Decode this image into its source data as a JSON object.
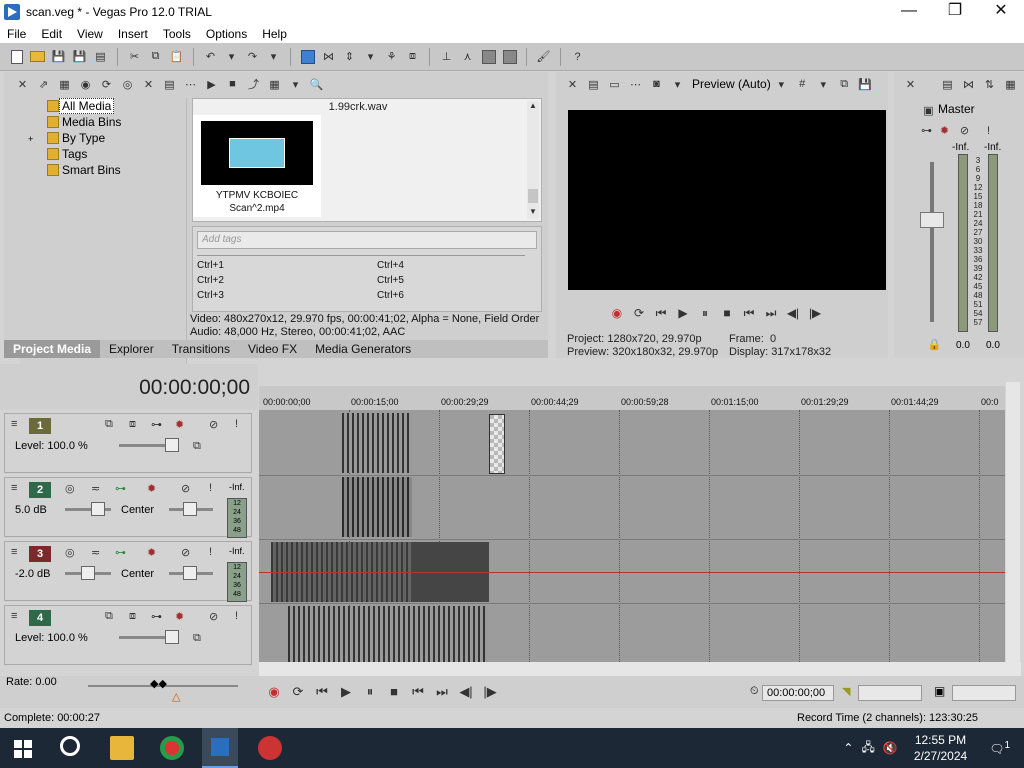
{
  "window": {
    "title": "scan.veg * - Vegas Pro 12.0 TRIAL",
    "minimize": "—",
    "maximize": "❐",
    "close": "✕"
  },
  "menu": [
    "File",
    "Edit",
    "View",
    "Insert",
    "Tools",
    "Options",
    "Help"
  ],
  "explorer": {
    "tree": [
      {
        "label": "All Media",
        "selected": true
      },
      {
        "label": "Media Bins"
      },
      {
        "label": "By Type",
        "expander": "+"
      },
      {
        "label": "Tags"
      },
      {
        "label": "Smart Bins"
      }
    ],
    "media_file_top": "1.99crk.wav",
    "thumb_caption_1": "YTPMV KCBOIEC",
    "thumb_caption_2": "Scan^2.mp4",
    "add_tags_placeholder": "Add tags",
    "shortcuts": [
      "Ctrl+1",
      "Ctrl+2",
      "Ctrl+3",
      "Ctrl+4",
      "Ctrl+5",
      "Ctrl+6"
    ],
    "info_video": "Video: 480x270x12, 29.970 fps, 00:00:41;02, Alpha = None, Field Order",
    "info_audio": "Audio: 48,000 Hz, Stereo, 00:00:41;02, AAC"
  },
  "tabs": [
    "Project Media",
    "Explorer",
    "Transitions",
    "Video FX",
    "Media Generators"
  ],
  "preview": {
    "mode": "Preview (Auto)",
    "project_label": "Project:",
    "project_value": "1280x720, 29.970p",
    "preview_label": "Preview:",
    "preview_value": "320x180x32, 29.970p",
    "frame_label": "Frame:",
    "frame_value": "0",
    "display_label": "Display:",
    "display_value": "317x178x32"
  },
  "mixer": {
    "master": "Master",
    "inf_left": "-Inf.",
    "inf_right": "-Inf.",
    "scale": [
      "3",
      "6",
      "9",
      "12",
      "15",
      "18",
      "21",
      "24",
      "27",
      "30",
      "33",
      "36",
      "39",
      "42",
      "45",
      "48",
      "51",
      "54",
      "57"
    ],
    "bottom_left": "0.0",
    "bottom_right": "0.0"
  },
  "timeline": {
    "timecode": "00:00:00;00",
    "ruler": [
      "00:00:00;00",
      "00:00:15;00",
      "00:00:29;29",
      "00:00:44;29",
      "00:00:59;28",
      "00:01:15;00",
      "00:01:29;29",
      "00:01:44;29",
      "00:0"
    ]
  },
  "tracks": [
    {
      "num": "1",
      "type": "video",
      "level": "Level: 100.0 %"
    },
    {
      "num": "2",
      "type": "audio",
      "volume": "5.0 dB",
      "pan": "Center",
      "vu_inf": "-Inf.",
      "vu": [
        "12",
        "24",
        "36",
        "48"
      ]
    },
    {
      "num": "3",
      "type": "audio",
      "volume": "-2.0 dB",
      "pan": "Center",
      "vu_inf": "-Inf.",
      "vu": [
        "12",
        "24",
        "36",
        "48"
      ]
    },
    {
      "num": "4",
      "type": "video",
      "level": "Level: 100.0 %"
    }
  ],
  "bottom": {
    "rate": "Rate: 0.00",
    "timecode": "00:00:00;00"
  },
  "status": {
    "left": "Complete: 00:00:27",
    "right": "Record Time (2 channels): 123:30:25"
  },
  "taskbar": {
    "time": "12:55 PM",
    "date": "2/27/2024",
    "notif_count": "1"
  }
}
